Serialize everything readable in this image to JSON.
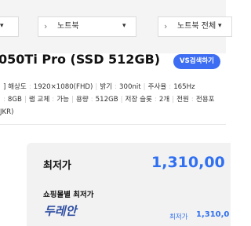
{
  "breadcrumbs": [
    {
      "label": "",
      "icon": "chevron-down-icon"
    },
    {
      "label": "노트북",
      "icon": "chevron-down-icon"
    },
    {
      "label": "노트북 전체",
      "icon": "chevron-down-icon"
    }
  ],
  "product": {
    "title": "050Ti Pro (SSD 512GB)",
    "compare_button": "VS검색하기"
  },
  "specs": {
    "line1": [
      {
        "k": "해상도",
        "v": "1920×1080(FHD)"
      },
      {
        "k": "밝기",
        "v": "300nit"
      },
      {
        "k": "주사율",
        "v": "165Hz"
      }
    ],
    "line1_prefix": "]",
    "line2": [
      {
        "k": "",
        "v": "8GB"
      },
      {
        "k": "램 교체",
        "v": "가능"
      },
      {
        "k": "용량",
        "v": "512GB"
      },
      {
        "k": "저장 슬롯",
        "v": "2개"
      },
      {
        "k": "전원",
        "v": "전용포"
      }
    ],
    "line3": "JKR)"
  },
  "price": {
    "label": "최저가",
    "value": "1,310,00",
    "mall_label": "쇼핑몰별 최저가",
    "mall_logo": "두레안",
    "mall_price_label": "최저가",
    "mall_price_value": "1,310,0"
  },
  "colors": {
    "accent": "#2f6ff1",
    "button": "#3d6df2"
  }
}
